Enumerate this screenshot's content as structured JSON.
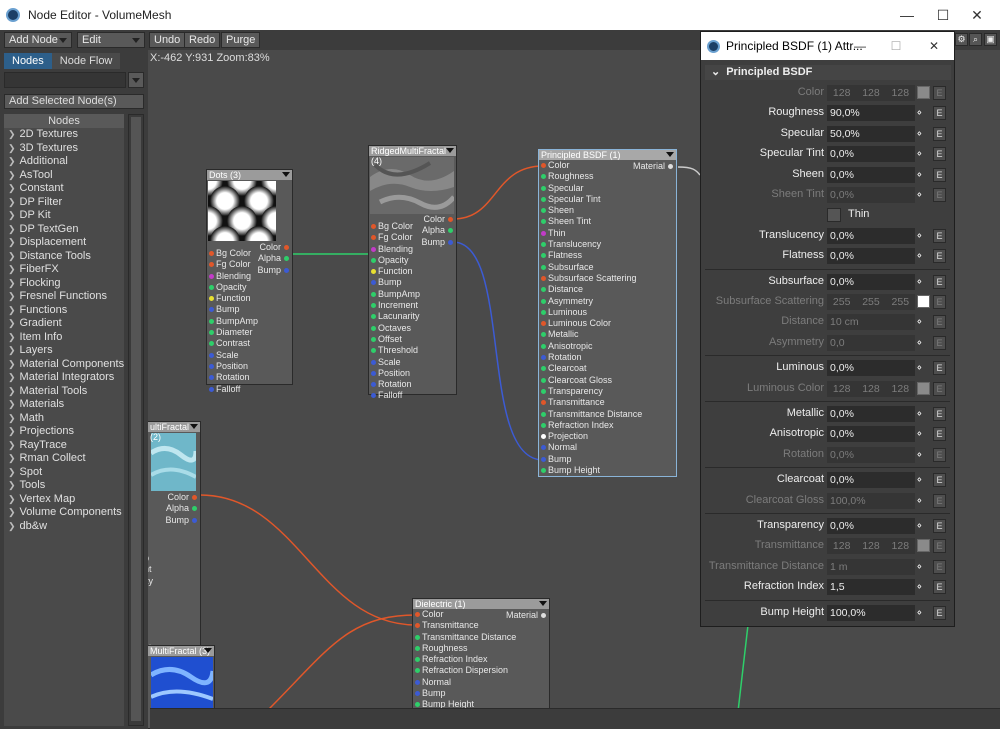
{
  "window": {
    "title": "Node Editor - VolumeMesh",
    "minimize": "—",
    "maximize": "☐",
    "close": "✕"
  },
  "toolbar": {
    "add_node": "Add Node",
    "edit": "Edit",
    "undo": "Undo",
    "redo": "Redo",
    "purge": "Purge"
  },
  "left": {
    "tab_nodes": "Nodes",
    "tab_nodeflow": "Node Flow",
    "add_selected": "Add Selected Node(s)",
    "list_header": "Nodes",
    "items": [
      "2D Textures",
      "3D Textures",
      "Additional",
      "AsTool",
      "Constant",
      "DP Filter",
      "DP Kit",
      "DP TextGen",
      "Displacement",
      "Distance Tools",
      "FiberFX",
      "Flocking",
      "Fresnel Functions",
      "Functions",
      "Gradient",
      "Item Info",
      "Layers",
      "Material Components",
      "Material Integrators",
      "Material Tools",
      "Materials",
      "Math",
      "Projections",
      "RayTrace",
      "Rman Collect",
      "Spot",
      "Tools",
      "Vertex Map",
      "Volume Components",
      "db&w"
    ]
  },
  "canvas": {
    "coords": "X:-462 Y:931 Zoom:83%"
  },
  "nodes": {
    "dots": {
      "title": "Dots (3)",
      "inputs": [
        "Bg Color",
        "Fg Color",
        "Blending",
        "Opacity",
        "Function",
        "Bump",
        "BumpAmp",
        "Diameter",
        "Contrast",
        "Scale",
        "Position",
        "Rotation",
        "Falloff"
      ],
      "outputs": [
        "Color",
        "Alpha",
        "Bump"
      ]
    },
    "ridged": {
      "title": "RidgedMultiFractal (4)",
      "inputs": [
        "Bg Color",
        "Fg Color",
        "Blending",
        "Opacity",
        "Function",
        "Bump",
        "BumpAmp",
        "Increment",
        "Lacunarity",
        "Octaves",
        "Offset",
        "Threshold",
        "Scale",
        "Position",
        "Rotation",
        "Falloff"
      ],
      "outputs": [
        "Color",
        "Alpha",
        "Bump"
      ]
    },
    "principled": {
      "title": "Principled BSDF (1)",
      "output": "Material",
      "inputs": [
        "Color",
        "Roughness",
        "Specular",
        "Specular Tint",
        "Sheen",
        "Sheen Tint",
        "Thin",
        "Translucency",
        "Flatness",
        "Subsurface",
        "Subsurface Scattering",
        "Distance",
        "Asymmetry",
        "Luminous",
        "Luminous Color",
        "Metallic",
        "Anisotropic",
        "Rotation",
        "Clearcoat",
        "Clearcoat Gloss",
        "Transparency",
        "Transmittance",
        "Transmittance Distance",
        "Refraction Index",
        "Projection",
        "Normal",
        "Bump",
        "Bump Height"
      ]
    },
    "fractal2": {
      "title": "ultiFractal (2)",
      "outputs": [
        "Color",
        "Alpha",
        "Bump"
      ],
      "partial": [
        "p",
        "nt",
        "ity",
        "",
        "",
        "",
        "",
        "",
        "ld"
      ]
    },
    "dielectric": {
      "title": "Dielectric (1)",
      "output": "Material",
      "inputs": [
        "Color",
        "Transmittance",
        "Transmittance Distance",
        "Roughness",
        "Refraction Index",
        "Refraction Dispersion",
        "Normal",
        "Bump",
        "Bump Height"
      ]
    },
    "fractal3": {
      "title": "MultiFractal (3)"
    }
  },
  "dialog": {
    "title": "Principled BSDF (1) Attr...",
    "section": "Principled BSDF",
    "rows": {
      "color": {
        "label": "Color",
        "r": "128",
        "g": "128",
        "b": "128"
      },
      "roughness": {
        "label": "Roughness",
        "value": "90,0%"
      },
      "specular": {
        "label": "Specular",
        "value": "50,0%"
      },
      "specular_tint": {
        "label": "Specular Tint",
        "value": "0,0%"
      },
      "sheen": {
        "label": "Sheen",
        "value": "0,0%"
      },
      "sheen_tint": {
        "label": "Sheen Tint",
        "value": "0,0%"
      },
      "thin": {
        "label": "Thin"
      },
      "translucency": {
        "label": "Translucency",
        "value": "0,0%"
      },
      "flatness": {
        "label": "Flatness",
        "value": "0,0%"
      },
      "subsurface": {
        "label": "Subsurface",
        "value": "0,0%"
      },
      "subsurface_scattering": {
        "label": "Subsurface Scattering",
        "r": "255",
        "g": "255",
        "b": "255"
      },
      "distance": {
        "label": "Distance",
        "value": "10 cm"
      },
      "asymmetry": {
        "label": "Asymmetry",
        "value": "0,0"
      },
      "luminous": {
        "label": "Luminous",
        "value": "0,0%"
      },
      "luminous_color": {
        "label": "Luminous Color",
        "r": "128",
        "g": "128",
        "b": "128"
      },
      "metallic": {
        "label": "Metallic",
        "value": "0,0%"
      },
      "anisotropic": {
        "label": "Anisotropic",
        "value": "0,0%"
      },
      "rotation": {
        "label": "Rotation",
        "value": "0,0%"
      },
      "clearcoat": {
        "label": "Clearcoat",
        "value": "0,0%"
      },
      "clearcoat_gloss": {
        "label": "Clearcoat Gloss",
        "value": "100,0%"
      },
      "transparency": {
        "label": "Transparency",
        "value": "0,0%"
      },
      "transmittance": {
        "label": "Transmittance",
        "r": "128",
        "g": "128",
        "b": "128"
      },
      "transmittance_distance": {
        "label": "Transmittance Distance",
        "value": "1 m"
      },
      "refraction_index": {
        "label": "Refraction Index",
        "value": "1,5"
      },
      "bump_height": {
        "label": "Bump Height",
        "value": "100,0%"
      }
    },
    "e_label": "E"
  },
  "colors": {
    "accent": "#2d5f8a",
    "link_red": "#e0572a",
    "link_green": "#2ecf6a",
    "link_blue": "#3c5bd4"
  }
}
